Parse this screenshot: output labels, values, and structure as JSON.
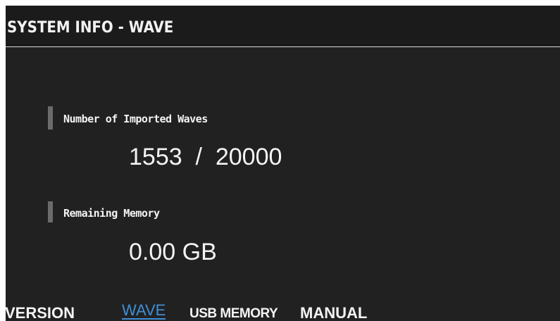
{
  "header": {
    "title": "SYSTEM INFO - WAVE"
  },
  "sections": [
    {
      "label": "Number of Imported Waves",
      "value": "1553  /  20000"
    },
    {
      "label": "Remaining Memory",
      "value": "0.00 GB"
    }
  ],
  "tabs": [
    {
      "label": "VERSION",
      "active": false
    },
    {
      "label": "WAVE",
      "active": true
    },
    {
      "label": "USB MEMORY",
      "active": false
    },
    {
      "label": "MANUAL",
      "active": false
    }
  ],
  "colors": {
    "background": "#212121",
    "text": "#f4f4f4",
    "accent": "#3f8fd6",
    "marker": "#6b6b6b"
  }
}
